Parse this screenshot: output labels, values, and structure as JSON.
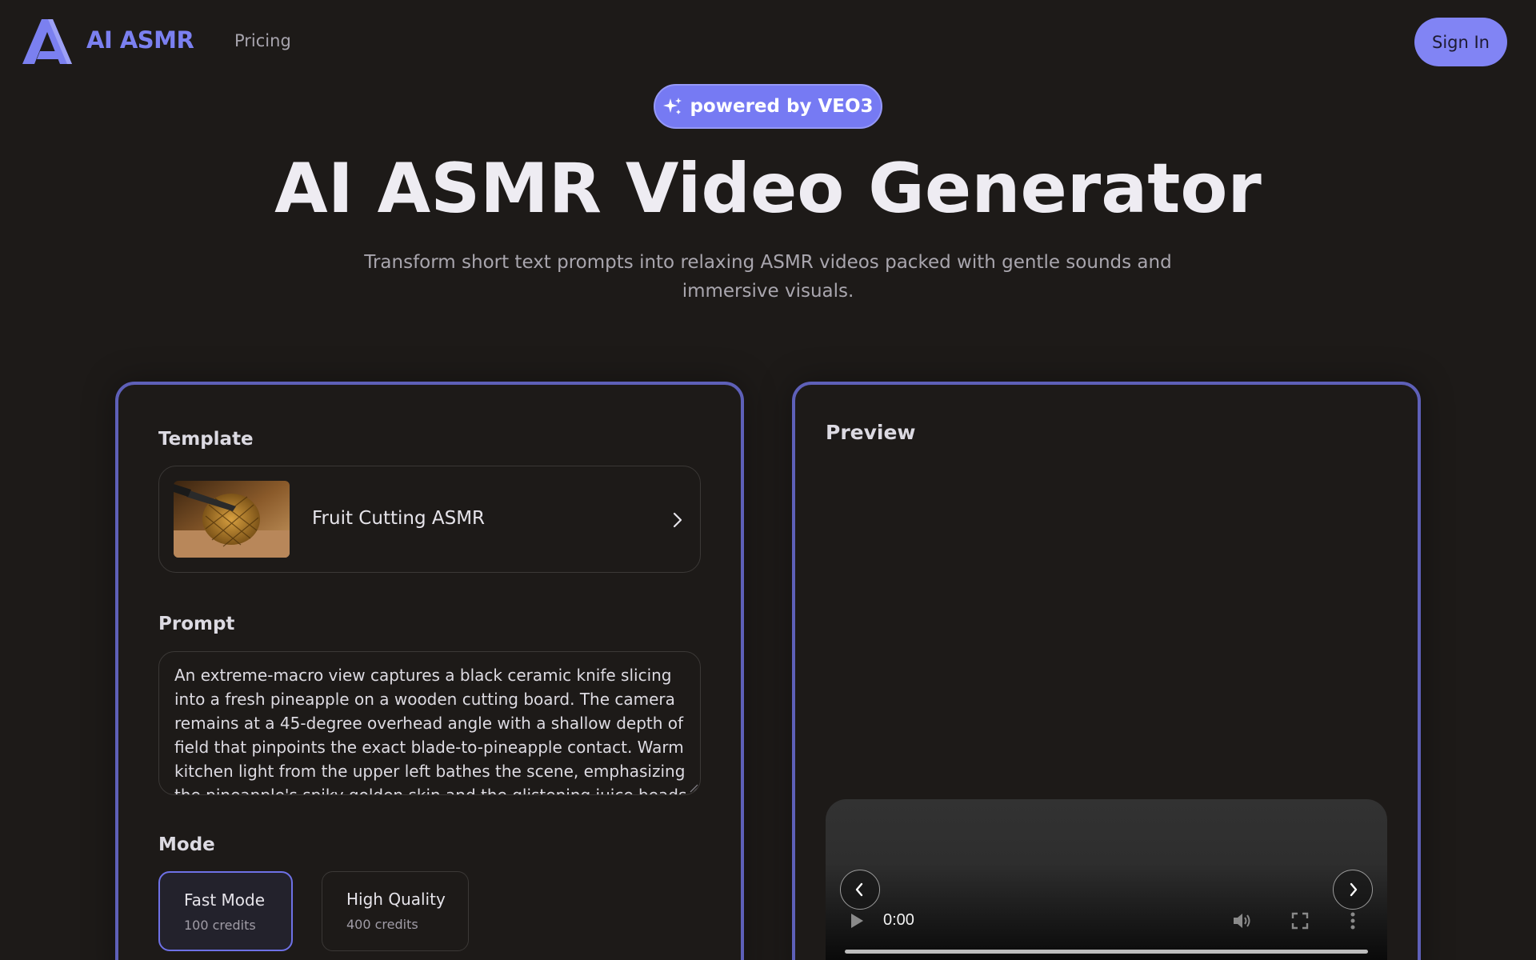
{
  "header": {
    "brand": "AI ASMR",
    "nav_pricing": "Pricing",
    "sign_in": "Sign In"
  },
  "hero": {
    "badge": "powered by VEO3",
    "title": "AI ASMR Video Generator",
    "subtitle": "Transform short text prompts into relaxing ASMR videos packed with gentle sounds and immersive visuals."
  },
  "form": {
    "template_label": "Template",
    "template_name": "Fruit Cutting ASMR",
    "prompt_label": "Prompt",
    "prompt_text": "An extreme-macro view captures a black ceramic knife slicing into a fresh pineapple on a wooden cutting board. The camera remains at a 45-degree overhead angle with a shallow depth of field that pinpoints the exact blade-to-pineapple contact. Warm kitchen light from the upper left bathes the scene, emphasizing the pineapple's spiky golden skin and the glistening juice beads",
    "mode_label": "Mode",
    "modes": [
      {
        "title": "Fast Mode",
        "credits": "100 credits",
        "selected": true
      },
      {
        "title": "High Quality",
        "credits": "400 credits",
        "selected": false
      }
    ]
  },
  "preview": {
    "title": "Preview",
    "time": "0:00"
  },
  "colors": {
    "background": "#1d1a18",
    "accent": "#7b80f0",
    "panel_border": "#5e60b8"
  },
  "icons": [
    "logo-a-icon",
    "sparkle-icon",
    "chevron-right-icon",
    "play-icon",
    "volume-icon",
    "fullscreen-icon",
    "more-vertical-icon",
    "chevron-left-icon"
  ]
}
